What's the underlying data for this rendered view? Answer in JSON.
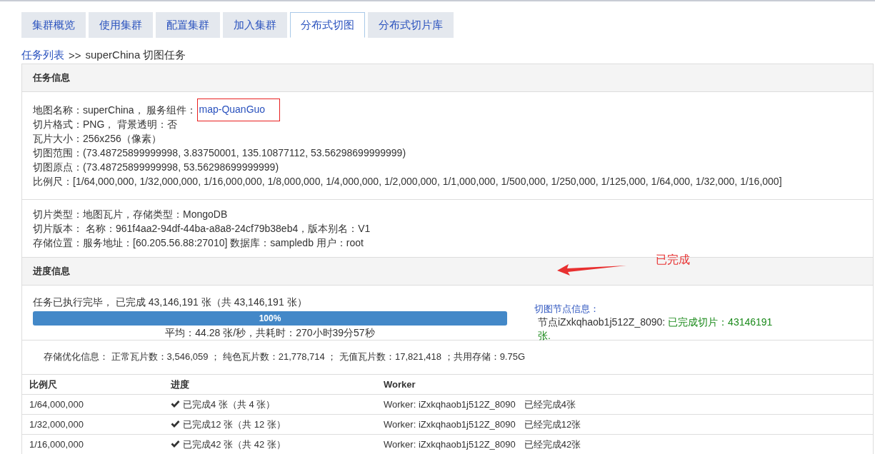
{
  "tabs": [
    {
      "label": "集群概览",
      "selected": false
    },
    {
      "label": "使用集群",
      "selected": false
    },
    {
      "label": "配置集群",
      "selected": false
    },
    {
      "label": "加入集群",
      "selected": false
    },
    {
      "label": "分布式切图",
      "selected": true
    },
    {
      "label": "分布式切片库",
      "selected": false
    }
  ],
  "breadcrumb": {
    "link": "任务列表",
    "separator": ">>",
    "current": "superChina 切图任务"
  },
  "task_info": {
    "title": "任务信息",
    "map_line": {
      "text": "地图名称：superChina， 服务组件：",
      "link": "map-QuanGuo",
      "annotated": true
    },
    "lines": [
      "切片格式：PNG， 背景透明：否",
      "瓦片大小：256x256（像素）",
      "切图范围：(73.48725899999998, 3.83750001, 135.10877112, 53.56298699999999)",
      "切图原点：(73.48725899999998, 53.56298699999999)",
      "比例尺：[1/64,000,000, 1/32,000,000, 1/16,000,000, 1/8,000,000, 1/4,000,000, 1/2,000,000, 1/1,000,000, 1/500,000, 1/250,000, 1/125,000, 1/64,000, 1/32,000, 1/16,000]"
    ],
    "storage_lines": [
      "切片类型：地图瓦片，存储类型：MongoDB",
      "切片版本： 名称：961f4aa2-94df-44ba-a8a8-24cf79b38eb4，版本别名：V1",
      "存储位置：服务地址：[60.205.56.88:27010]  数据库：sampledb  用户：root"
    ]
  },
  "progress_info": {
    "title": "进度信息",
    "annotation": {
      "text": "已完成"
    },
    "summary": "任务已执行完毕， 已完成 43,146,191 张（共 43,146,191 张）",
    "level": 1,
    "percent": "100%",
    "speed": "平均：44.28 张/秒，共耗时：270小时39分57秒",
    "node_info": {
      "title": "切图节点信息：",
      "node": "节点iZxkqhaob1j512Z_8090:",
      "result": "已完成切片：43146191 张."
    },
    "storage_summary": "存储优化信息： 正常瓦片数：3,546,059 ； 纯色瓦片数：21,778,714 ； 无值瓦片数：17,821,418 ；共用存储：9.75G"
  },
  "table": {
    "columns": [
      "比例尺",
      "进度",
      "Worker"
    ],
    "rows": [
      {
        "scale": "1/64,000,000",
        "done": true,
        "progress": "已完成4 张（共 4 张）",
        "worker": "Worker: iZxkqhaob1j512Z_8090",
        "worker_status": "已经完成4张"
      },
      {
        "scale": "1/32,000,000",
        "done": true,
        "progress": "已完成12 张（共 12 张）",
        "worker": "Worker: iZxkqhaob1j512Z_8090",
        "worker_status": "已经完成12张"
      },
      {
        "scale": "1/16,000,000",
        "done": true,
        "progress": "已完成42 张（共 42 张）",
        "worker": "Worker: iZxkqhaob1j512Z_8090",
        "worker_status": "已经完成42张"
      }
    ]
  }
}
